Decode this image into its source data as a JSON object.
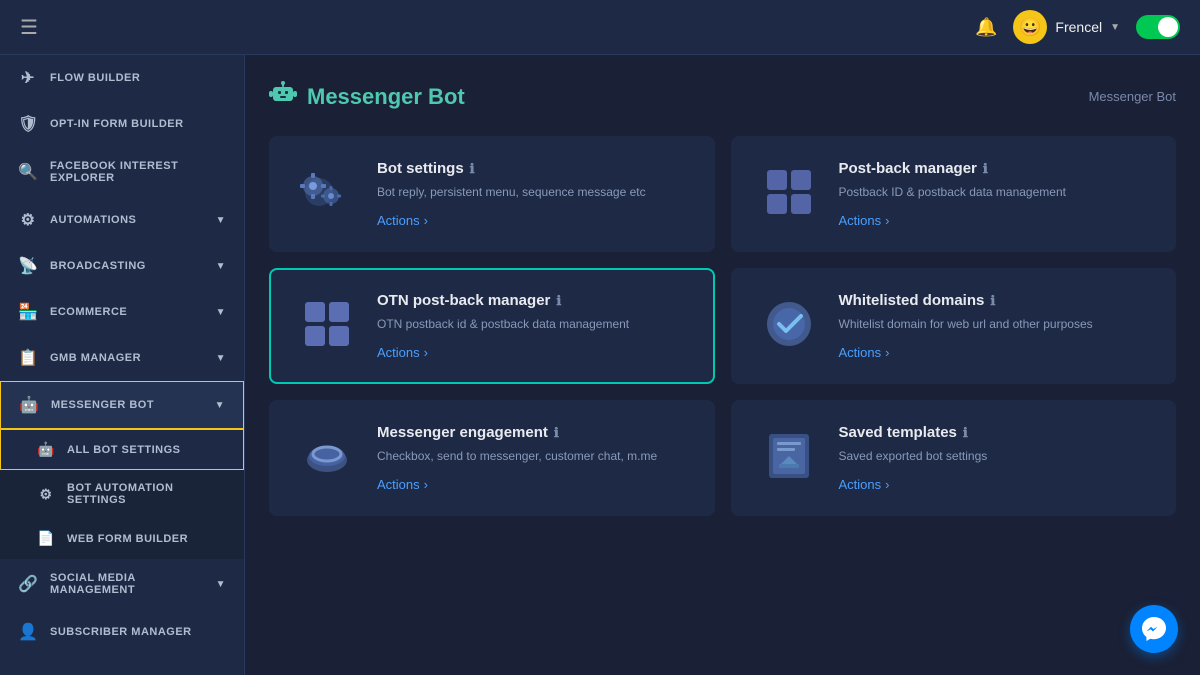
{
  "header": {
    "hamburger_label": "☰",
    "bell_label": "🔔",
    "username": "Frencel",
    "avatar_emoji": "😀",
    "toggle_on": true
  },
  "sidebar": {
    "items": [
      {
        "id": "flow-builder",
        "label": "FLOW BUILDER",
        "icon": "✈",
        "has_sub": false,
        "active": false
      },
      {
        "id": "opt-in-form",
        "label": "OPT-IN FORM BUILDER",
        "icon": "🛡",
        "has_sub": false,
        "active": false
      },
      {
        "id": "fb-interest",
        "label": "FACEBOOK INTEREST EXPLORER",
        "icon": "🔍",
        "has_sub": false,
        "active": false
      },
      {
        "id": "automations",
        "label": "AUTOMATIONS",
        "icon": "⚙",
        "has_sub": true,
        "active": false
      },
      {
        "id": "broadcasting",
        "label": "BROADCASTING",
        "icon": "📡",
        "has_sub": true,
        "active": false
      },
      {
        "id": "ecommerce",
        "label": "ECOMMERCE",
        "icon": "🏪",
        "has_sub": true,
        "active": false
      },
      {
        "id": "gmb-manager",
        "label": "GMB MANAGER",
        "icon": "📋",
        "has_sub": true,
        "active": false
      },
      {
        "id": "messenger-bot",
        "label": "MESSENGER BOT",
        "icon": "🤖",
        "has_sub": true,
        "active": true
      },
      {
        "id": "social-media",
        "label": "SOCIAL MEDIA MANAGEMENT",
        "icon": "🔗",
        "has_sub": true,
        "active": false
      },
      {
        "id": "subscriber",
        "label": "SUBSCRIBER MANAGER",
        "icon": "👤",
        "has_sub": false,
        "active": false
      }
    ],
    "sub_items": [
      {
        "id": "all-bot-settings",
        "label": "ALL BOT SETTINGS",
        "icon": "🤖",
        "active": true
      },
      {
        "id": "bot-automation",
        "label": "BOT AUTOMATION SETTINGS",
        "icon": "⚙",
        "active": false
      },
      {
        "id": "web-form-builder",
        "label": "WEB FORM BUILDER",
        "icon": "📄",
        "active": false
      }
    ]
  },
  "page": {
    "title": "Messenger Bot",
    "icon": "🤖",
    "breadcrumb": "Messenger Bot"
  },
  "cards": [
    {
      "id": "bot-settings",
      "title": "Bot settings",
      "desc": "Bot reply, persistent menu, sequence message etc",
      "action_label": "Actions",
      "icon_type": "gear",
      "highlighted": false
    },
    {
      "id": "post-back-manager",
      "title": "Post-back manager",
      "desc": "Postback ID & postback data management",
      "action_label": "Actions",
      "icon_type": "grid",
      "highlighted": false
    },
    {
      "id": "otn-post-back",
      "title": "OTN post-back manager",
      "desc": "OTN postback id & postback data management",
      "action_label": "Actions",
      "icon_type": "grid",
      "highlighted": true
    },
    {
      "id": "whitelisted-domains",
      "title": "Whitelisted domains",
      "desc": "Whitelist domain for web url and other purposes",
      "action_label": "Actions",
      "icon_type": "check",
      "highlighted": false
    },
    {
      "id": "messenger-engagement",
      "title": "Messenger engagement",
      "desc": "Checkbox, send to messenger, customer chat, m.me",
      "action_label": "Actions",
      "icon_type": "ring",
      "highlighted": false
    },
    {
      "id": "saved-templates",
      "title": "Saved templates",
      "desc": "Saved exported bot settings",
      "action_label": "Actions",
      "icon_type": "save",
      "highlighted": false
    }
  ],
  "fab": {
    "icon": "💬"
  }
}
